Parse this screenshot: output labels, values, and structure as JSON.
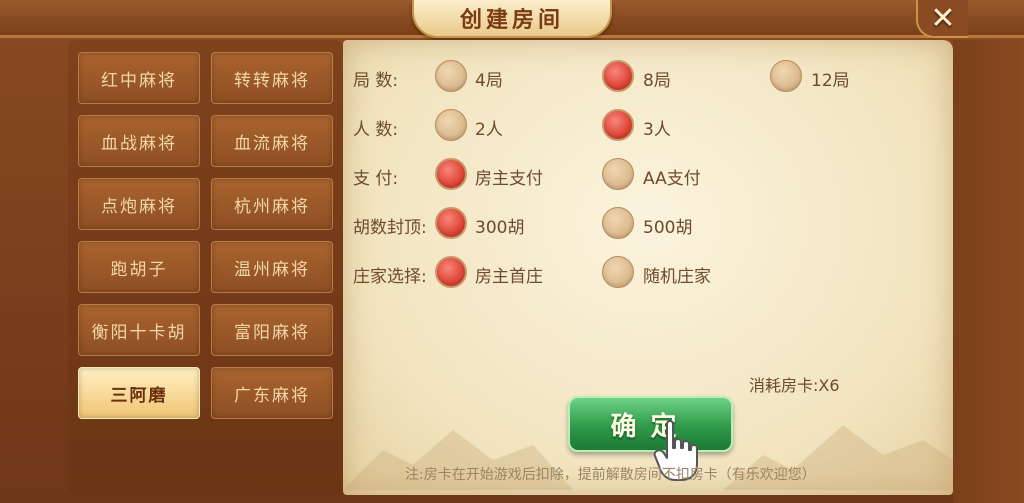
{
  "header": {
    "title": "创建房间",
    "close_symbol": "✕"
  },
  "game_modes": [
    {
      "label": "红中麻将",
      "selected": false
    },
    {
      "label": "转转麻将",
      "selected": false
    },
    {
      "label": "血战麻将",
      "selected": false
    },
    {
      "label": "血流麻将",
      "selected": false
    },
    {
      "label": "点炮麻将",
      "selected": false
    },
    {
      "label": "杭州麻将",
      "selected": false
    },
    {
      "label": "跑胡子",
      "selected": false
    },
    {
      "label": "温州麻将",
      "selected": false
    },
    {
      "label": "衡阳十卡胡",
      "selected": false
    },
    {
      "label": "富阳麻将",
      "selected": false
    },
    {
      "label": "三阿磨",
      "selected": true
    },
    {
      "label": "广东麻将",
      "selected": false
    }
  ],
  "options": {
    "rounds": {
      "label": "局  数:",
      "choices": [
        {
          "text": "4局",
          "checked": false
        },
        {
          "text": "8局",
          "checked": true
        },
        {
          "text": "12局",
          "checked": false
        }
      ]
    },
    "players": {
      "label": "人  数:",
      "choices": [
        {
          "text": "2人",
          "checked": false
        },
        {
          "text": "3人",
          "checked": true
        }
      ]
    },
    "payment": {
      "label": "支  付:",
      "choices": [
        {
          "text": "房主支付",
          "checked": true
        },
        {
          "text": "AA支付",
          "checked": false
        }
      ]
    },
    "cap": {
      "label": "胡数封顶:",
      "choices": [
        {
          "text": "300胡",
          "checked": true
        },
        {
          "text": "500胡",
          "checked": false
        }
      ]
    },
    "dealer": {
      "label": "庄家选择:",
      "choices": [
        {
          "text": "房主首庄",
          "checked": true
        },
        {
          "text": "随机庄家",
          "checked": false
        }
      ]
    }
  },
  "cost_text": "消耗房卡:X6",
  "confirm_label": "确定",
  "note": "注:房卡在开始游戏后扣除，提前解散房间不扣房卡（有乐欢迎您）",
  "colors": {
    "checked_radio": "#e04a3c",
    "confirm_button": "#2e9a4a",
    "active_tab": "#f0c474"
  }
}
